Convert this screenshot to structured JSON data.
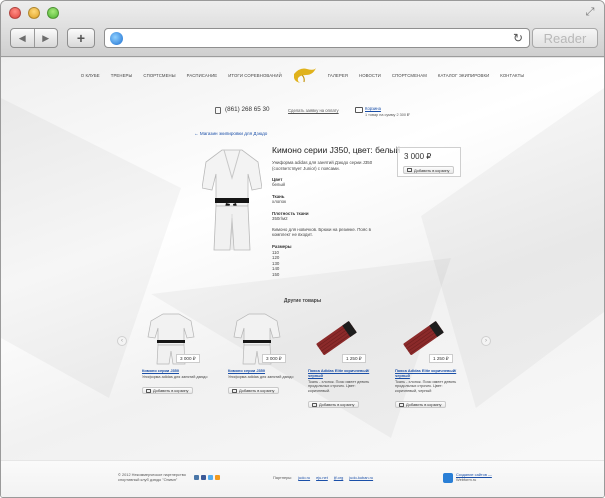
{
  "browser": {
    "reader_label": "Reader"
  },
  "menu": {
    "left": [
      "О КЛУБЕ",
      "ТРЕНЕРЫ",
      "СПОРТСМЕНЫ",
      "РАСПИСАНИЕ",
      "ИТОГИ СОРЕВНОВАНИЙ"
    ],
    "right": [
      "ГАЛЕРЕЯ",
      "НОВОСТИ",
      "СПОРТСМЕНАМ",
      "КАТАЛОГ ЭКИПИРОВКИ",
      "КОНТАКТЫ"
    ]
  },
  "contact": {
    "phone": "(861) 268 65 30",
    "callback_label": "Сделать заявку на оплату",
    "cart_label": "Корзина",
    "cart_summary": "1 товар на сумму 2 300 ₽"
  },
  "back_link": "← Магазин экипировки для Дзюдо",
  "product": {
    "title": "Кимоно серии J350, цвет: белый",
    "description": "Униформа adidas для занятий Дзюдо серии J350 (соответствует Junior) с поясами.",
    "props": [
      {
        "key": "Цвет",
        "value": "белый"
      },
      {
        "key": "Ткань",
        "value": "хлопок"
      },
      {
        "key": "Плотность ткани",
        "value": "350г/м2"
      }
    ],
    "note": "Кимоно для новичков. Брюки на резинке. Пояс в комплект не входит.",
    "sizes_label": "Размеры",
    "sizes": [
      "110",
      "120",
      "130",
      "140",
      "150"
    ],
    "price": "3 000 ₽",
    "buy_label": "Добавить в корзину"
  },
  "related": {
    "title": "Другие товары",
    "items": [
      {
        "name": "Кимоно серии J350",
        "desc": "Униформа adidas для занятий дзюдо",
        "price": "3 000 ₽",
        "buy": "Добавить в корзину",
        "image": "kimono"
      },
      {
        "name": "Кимоно серии J350",
        "desc": "Униформа adidas для занятий дзюдо",
        "price": "3 000 ₽",
        "buy": "Добавить в корзину",
        "image": "kimono"
      },
      {
        "name": "Пояса Adidas Elite коричневый/черный",
        "desc": "Ткань - хлопок. Пояс имеет девять продольных строчек. Цвет: коричневый.",
        "price": "1 250 ₽",
        "buy": "Добавить в корзину",
        "image": "belt"
      },
      {
        "name": "Пояса Adidas Elite коричневый/черный",
        "desc": "Ткань - хлопок. Пояс имеет девять продольных строчек. Цвет: коричневый, черный",
        "price": "1 250 ₽",
        "buy": "Добавить в корзину",
        "image": "belt"
      }
    ]
  },
  "footer": {
    "copyright": "© 2012 Некоммерческое партнерство спортивный клуб дзюдо \"Олимп\"",
    "partners_label": "Партнеры:",
    "partners": [
      "judo.ru",
      "eju.net",
      "ijf.org",
      "judo-kuban.ru"
    ],
    "dev_link": "Создание сайтов —",
    "dev_name": "Webform.ru"
  },
  "colors": {
    "link": "#1a4fa8",
    "belt": "#8b2a2a"
  }
}
